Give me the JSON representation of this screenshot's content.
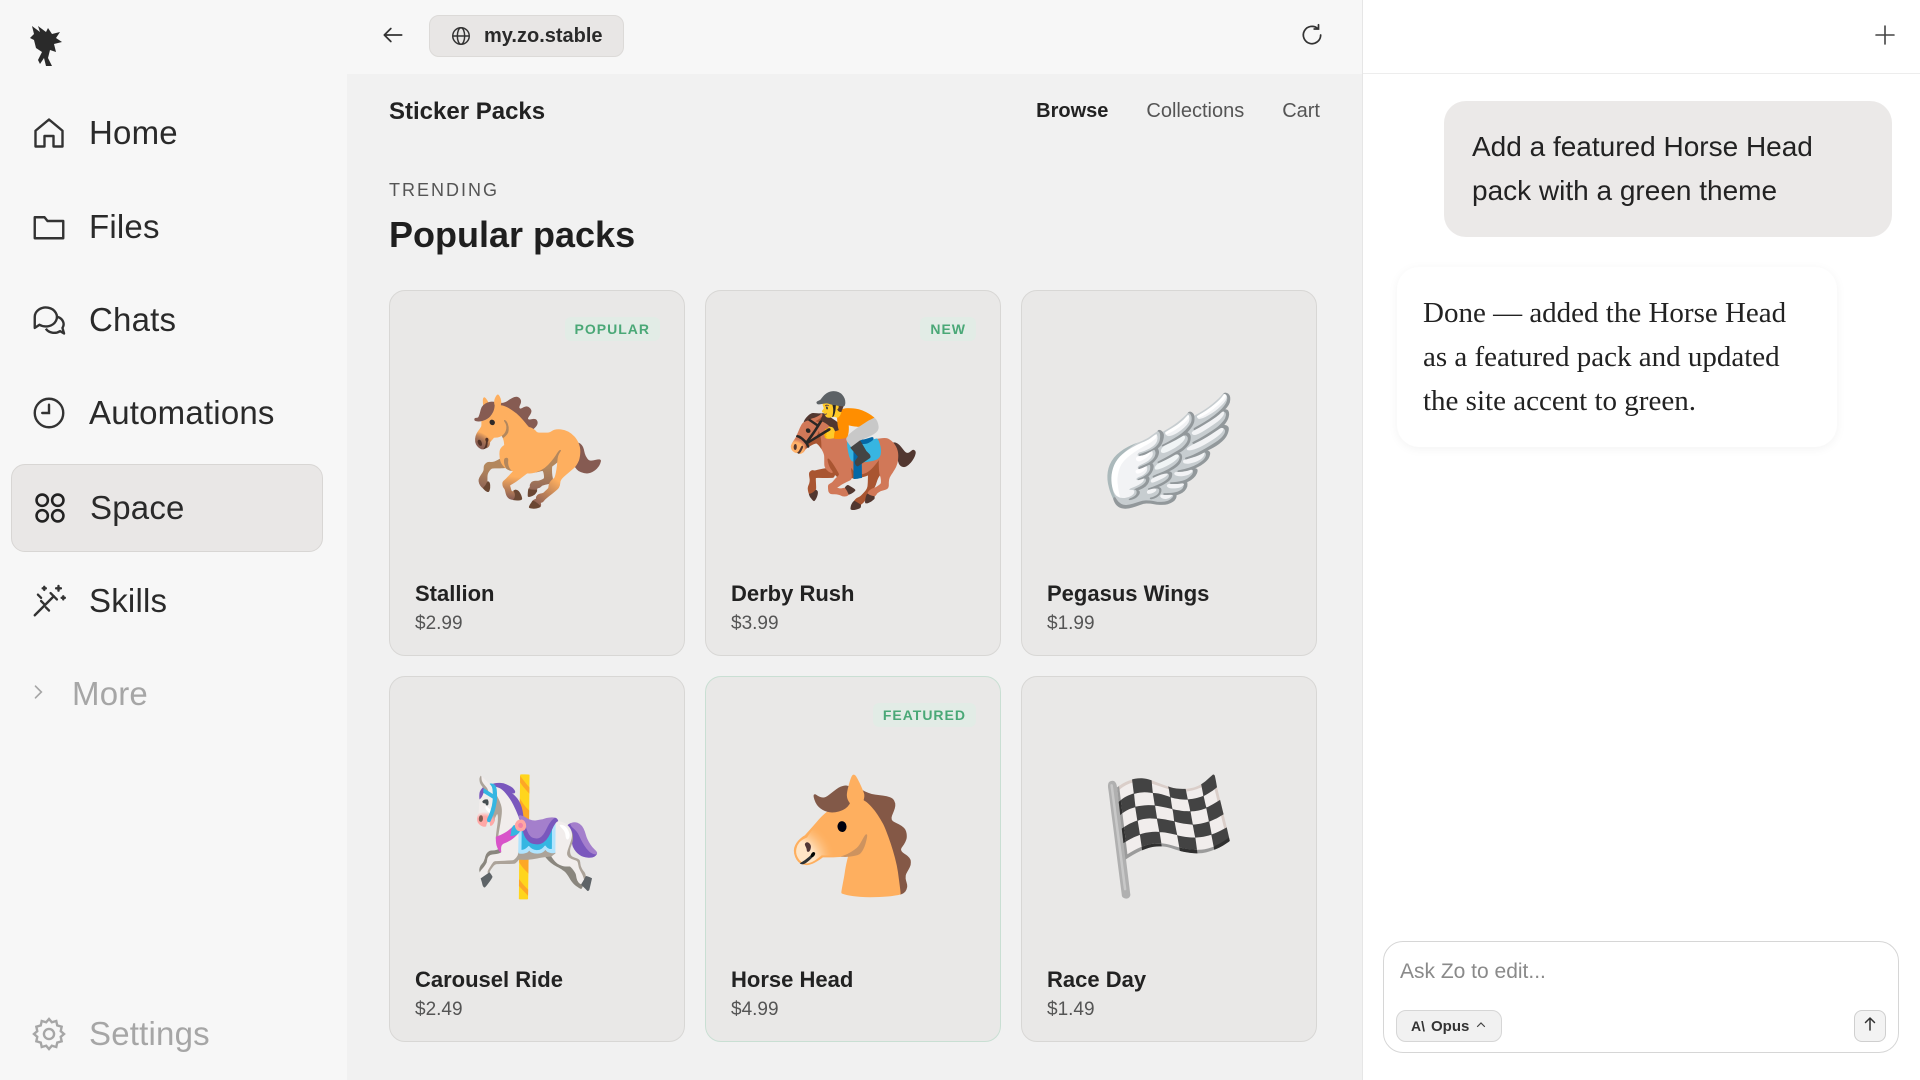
{
  "sidebar": {
    "logo_icon": "pegasus-logo-icon",
    "items": [
      {
        "label": "Home",
        "icon": "home-icon"
      },
      {
        "label": "Files",
        "icon": "folder-icon"
      },
      {
        "label": "Chats",
        "icon": "chat-bubbles-icon"
      },
      {
        "label": "Automations",
        "icon": "clock-icon"
      },
      {
        "label": "Space",
        "icon": "grid-circles-icon",
        "active": true
      },
      {
        "label": "Skills",
        "icon": "magic-wand-icon"
      }
    ],
    "more_label": "More",
    "settings_label": "Settings"
  },
  "browser": {
    "url": "my.zo.stable"
  },
  "site": {
    "title": "Sticker Packs",
    "nav": [
      "Browse",
      "Collections",
      "Cart"
    ],
    "section_kicker": "TRENDING",
    "section_title": "Popular packs",
    "accent_color": "#4aa877",
    "packs": [
      {
        "name": "Stallion",
        "price": "$2.99",
        "badge": "POPULAR",
        "emoji": "🐎"
      },
      {
        "name": "Derby Rush",
        "price": "$3.99",
        "badge": "NEW",
        "emoji": "🏇"
      },
      {
        "name": "Pegasus Wings",
        "price": "$1.99",
        "badge": "",
        "emoji": "🪽"
      },
      {
        "name": "Carousel Ride",
        "price": "$2.49",
        "badge": "",
        "emoji": "🎠"
      },
      {
        "name": "Horse Head",
        "price": "$4.99",
        "badge": "FEATURED",
        "emoji": "🐴"
      },
      {
        "name": "Race Day",
        "price": "$1.49",
        "badge": "",
        "emoji": "🏁"
      }
    ]
  },
  "chat": {
    "user_message": "Add a featured Horse Head pack with a green theme",
    "assistant_message": "Done — added the Horse Head as a featured pack and updated the site accent to green.",
    "input_placeholder": "Ask Zo to edit...",
    "model_label": "Opus"
  }
}
